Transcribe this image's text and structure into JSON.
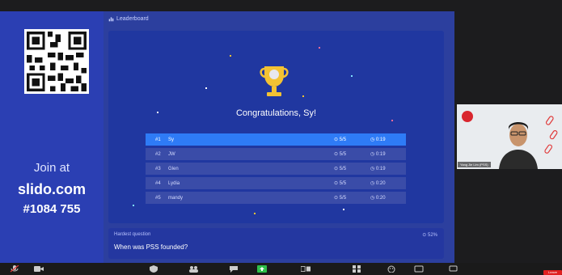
{
  "slide": {
    "join": {
      "label": "Join at",
      "domain": "slido.com",
      "code": "#1084 755"
    },
    "panel_title": "Leaderboard",
    "congrats": "Congratulations, Sy!",
    "leaderboard": [
      {
        "rank": "#1",
        "name": "Sy",
        "score": "5/5",
        "time": "0:19"
      },
      {
        "rank": "#2",
        "name": "JW",
        "score": "5/5",
        "time": "0:19"
      },
      {
        "rank": "#3",
        "name": "Glen",
        "score": "5/5",
        "time": "0:19"
      },
      {
        "rank": "#4",
        "name": "Lydia",
        "score": "5/5",
        "time": "0:20"
      },
      {
        "rank": "#5",
        "name": "mandy",
        "score": "5/5",
        "time": "0:20"
      }
    ],
    "hardest": {
      "label": "Hardest question",
      "question": "When was PSS founded?",
      "percent": "52%"
    }
  },
  "camera": {
    "participant_name": "Yang Jie Lim (PSS)"
  },
  "toolbar": {
    "leave_label": "Leave"
  },
  "colors": {
    "slide_bg": "#2a3fae",
    "highlight": "#2e7bf6",
    "leave": "#e02020"
  }
}
